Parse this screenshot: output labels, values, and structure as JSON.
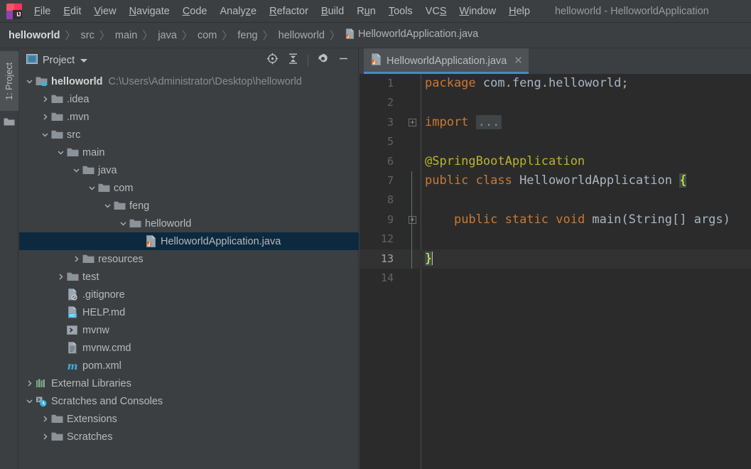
{
  "window": {
    "title": "helloworld - HelloworldApplication",
    "logo_icon": "intellij-idea-logo"
  },
  "menubar": {
    "items": [
      {
        "label": "File",
        "mnemonic": "F"
      },
      {
        "label": "Edit",
        "mnemonic": "E"
      },
      {
        "label": "View",
        "mnemonic": "V"
      },
      {
        "label": "Navigate",
        "mnemonic": "N"
      },
      {
        "label": "Code",
        "mnemonic": "C"
      },
      {
        "label": "Analyze",
        "mnemonic": "z"
      },
      {
        "label": "Refactor",
        "mnemonic": "R"
      },
      {
        "label": "Build",
        "mnemonic": "B"
      },
      {
        "label": "Run",
        "mnemonic": "u"
      },
      {
        "label": "Tools",
        "mnemonic": "T"
      },
      {
        "label": "VCS",
        "mnemonic": "S"
      },
      {
        "label": "Window",
        "mnemonic": "W"
      },
      {
        "label": "Help",
        "mnemonic": "H"
      }
    ]
  },
  "breadcrumb": {
    "separator": "〉",
    "items": [
      {
        "label": "helloworld",
        "type": "root"
      },
      {
        "label": "src",
        "type": "dir"
      },
      {
        "label": "main",
        "type": "dir"
      },
      {
        "label": "java",
        "type": "dir"
      },
      {
        "label": "com",
        "type": "dir"
      },
      {
        "label": "feng",
        "type": "dir"
      },
      {
        "label": "helloworld",
        "type": "dir"
      },
      {
        "label": "HelloworldApplication.java",
        "type": "java-file"
      }
    ]
  },
  "toolstrip": {
    "project_button_label": "1: Project",
    "folder_icon": "folder-icon"
  },
  "project_panel": {
    "title": "Project",
    "view_icon": "project-view-icon",
    "dropdown_icon": "chevron-down-icon",
    "tools": [
      {
        "name": "locate-icon",
        "title": "Select Opened File"
      },
      {
        "name": "collapse-all-icon",
        "title": "Collapse All"
      },
      {
        "name": "gear-icon",
        "title": "Settings"
      },
      {
        "name": "minimize-icon",
        "title": "Hide"
      }
    ],
    "tree": [
      {
        "label": "helloworld",
        "depth": 0,
        "arrow": "down",
        "icon": "module-folder-icon",
        "bold": true,
        "path": "C:\\Users\\Administrator\\Desktop\\helloworld",
        "selected": false
      },
      {
        "label": ".idea",
        "depth": 1,
        "arrow": "right",
        "icon": "folder-icon",
        "bold": false,
        "path": "",
        "selected": false
      },
      {
        "label": ".mvn",
        "depth": 1,
        "arrow": "right",
        "icon": "folder-icon",
        "bold": false,
        "path": "",
        "selected": false
      },
      {
        "label": "src",
        "depth": 1,
        "arrow": "down",
        "icon": "folder-icon",
        "bold": false,
        "path": "",
        "selected": false
      },
      {
        "label": "main",
        "depth": 2,
        "arrow": "down",
        "icon": "folder-icon",
        "bold": false,
        "path": "",
        "selected": false
      },
      {
        "label": "java",
        "depth": 3,
        "arrow": "down",
        "icon": "folder-icon",
        "bold": false,
        "path": "",
        "selected": false
      },
      {
        "label": "com",
        "depth": 4,
        "arrow": "down",
        "icon": "folder-icon",
        "bold": false,
        "path": "",
        "selected": false
      },
      {
        "label": "feng",
        "depth": 5,
        "arrow": "down",
        "icon": "folder-icon",
        "bold": false,
        "path": "",
        "selected": false
      },
      {
        "label": "helloworld",
        "depth": 6,
        "arrow": "down",
        "icon": "folder-icon",
        "bold": false,
        "path": "",
        "selected": false
      },
      {
        "label": "HelloworldApplication.java",
        "depth": 7,
        "arrow": "none",
        "icon": "java-class-icon",
        "bold": false,
        "path": "",
        "selected": true
      },
      {
        "label": "resources",
        "depth": 3,
        "arrow": "right",
        "icon": "folder-icon",
        "bold": false,
        "path": "",
        "selected": false
      },
      {
        "label": "test",
        "depth": 2,
        "arrow": "right",
        "icon": "folder-icon",
        "bold": false,
        "path": "",
        "selected": false
      },
      {
        "label": ".gitignore",
        "depth": 2,
        "arrow": "none",
        "icon": "gitignore-file-icon",
        "bold": false,
        "path": "",
        "selected": false
      },
      {
        "label": "HELP.md",
        "depth": 2,
        "arrow": "none",
        "icon": "markdown-file-icon",
        "bold": false,
        "path": "",
        "selected": false
      },
      {
        "label": "mvnw",
        "depth": 2,
        "arrow": "none",
        "icon": "shell-script-icon",
        "bold": false,
        "path": "",
        "selected": false
      },
      {
        "label": "mvnw.cmd",
        "depth": 2,
        "arrow": "none",
        "icon": "text-file-icon",
        "bold": false,
        "path": "",
        "selected": false
      },
      {
        "label": "pom.xml",
        "depth": 2,
        "arrow": "none",
        "icon": "maven-file-icon",
        "bold": false,
        "path": "",
        "selected": false
      },
      {
        "label": "External Libraries",
        "depth": 0,
        "arrow": "right",
        "icon": "external-libraries-icon",
        "bold": false,
        "path": "",
        "selected": false
      },
      {
        "label": "Scratches and Consoles",
        "depth": 0,
        "arrow": "down",
        "icon": "scratches-icon",
        "bold": false,
        "path": "",
        "selected": false
      },
      {
        "label": "Extensions",
        "depth": 1,
        "arrow": "right",
        "icon": "folder-icon",
        "bold": false,
        "path": "",
        "selected": false
      },
      {
        "label": "Scratches",
        "depth": 1,
        "arrow": "right",
        "icon": "folder-icon",
        "bold": false,
        "path": "",
        "selected": false
      }
    ]
  },
  "editor": {
    "tabs": [
      {
        "label": "HelloworldApplication.java",
        "icon": "java-class-icon",
        "close_icon": "close-icon",
        "active": true
      }
    ],
    "lines": [
      {
        "number": "1",
        "current": false,
        "fold": false,
        "indent_guide": false
      },
      {
        "number": "2",
        "current": false,
        "fold": false,
        "indent_guide": false
      },
      {
        "number": "3",
        "current": false,
        "fold": true,
        "indent_guide": false
      },
      {
        "number": "5",
        "current": false,
        "fold": false,
        "indent_guide": false
      },
      {
        "number": "6",
        "current": false,
        "fold": false,
        "indent_guide": false
      },
      {
        "number": "7",
        "current": false,
        "fold": false,
        "indent_guide": true
      },
      {
        "number": "8",
        "current": false,
        "fold": false,
        "indent_guide": true
      },
      {
        "number": "9",
        "current": false,
        "fold": true,
        "indent_guide": true
      },
      {
        "number": "12",
        "current": false,
        "fold": false,
        "indent_guide": true
      },
      {
        "number": "13",
        "current": true,
        "fold": false,
        "indent_guide": true
      },
      {
        "number": "14",
        "current": false,
        "fold": false,
        "indent_guide": false
      }
    ],
    "code": {
      "l1_kw": "package",
      "l1_rest": " com.feng.helloworld;",
      "l3_kw": "import",
      "l3_folded": "...",
      "l6_annotation": "@SpringBootApplication",
      "l7_kw1": "public",
      "l7_kw2": "class",
      "l7_name": "HelloworldApplication",
      "l7_brace": "{",
      "l9_kw1": "public",
      "l9_kw2": "static",
      "l9_kw3": "void",
      "l9_rest": "main(String[] args)",
      "l13_brace": "}"
    }
  },
  "colors": {
    "panel_bg": "#3c3f41",
    "editor_bg": "#2b2b2b",
    "selection_bg": "#0d293f",
    "keyword": "#cc7832",
    "annotation": "#bbb529",
    "identifier": "#a9b7c6",
    "tab_underline": "#4a88c7",
    "line_number": "#606366"
  }
}
